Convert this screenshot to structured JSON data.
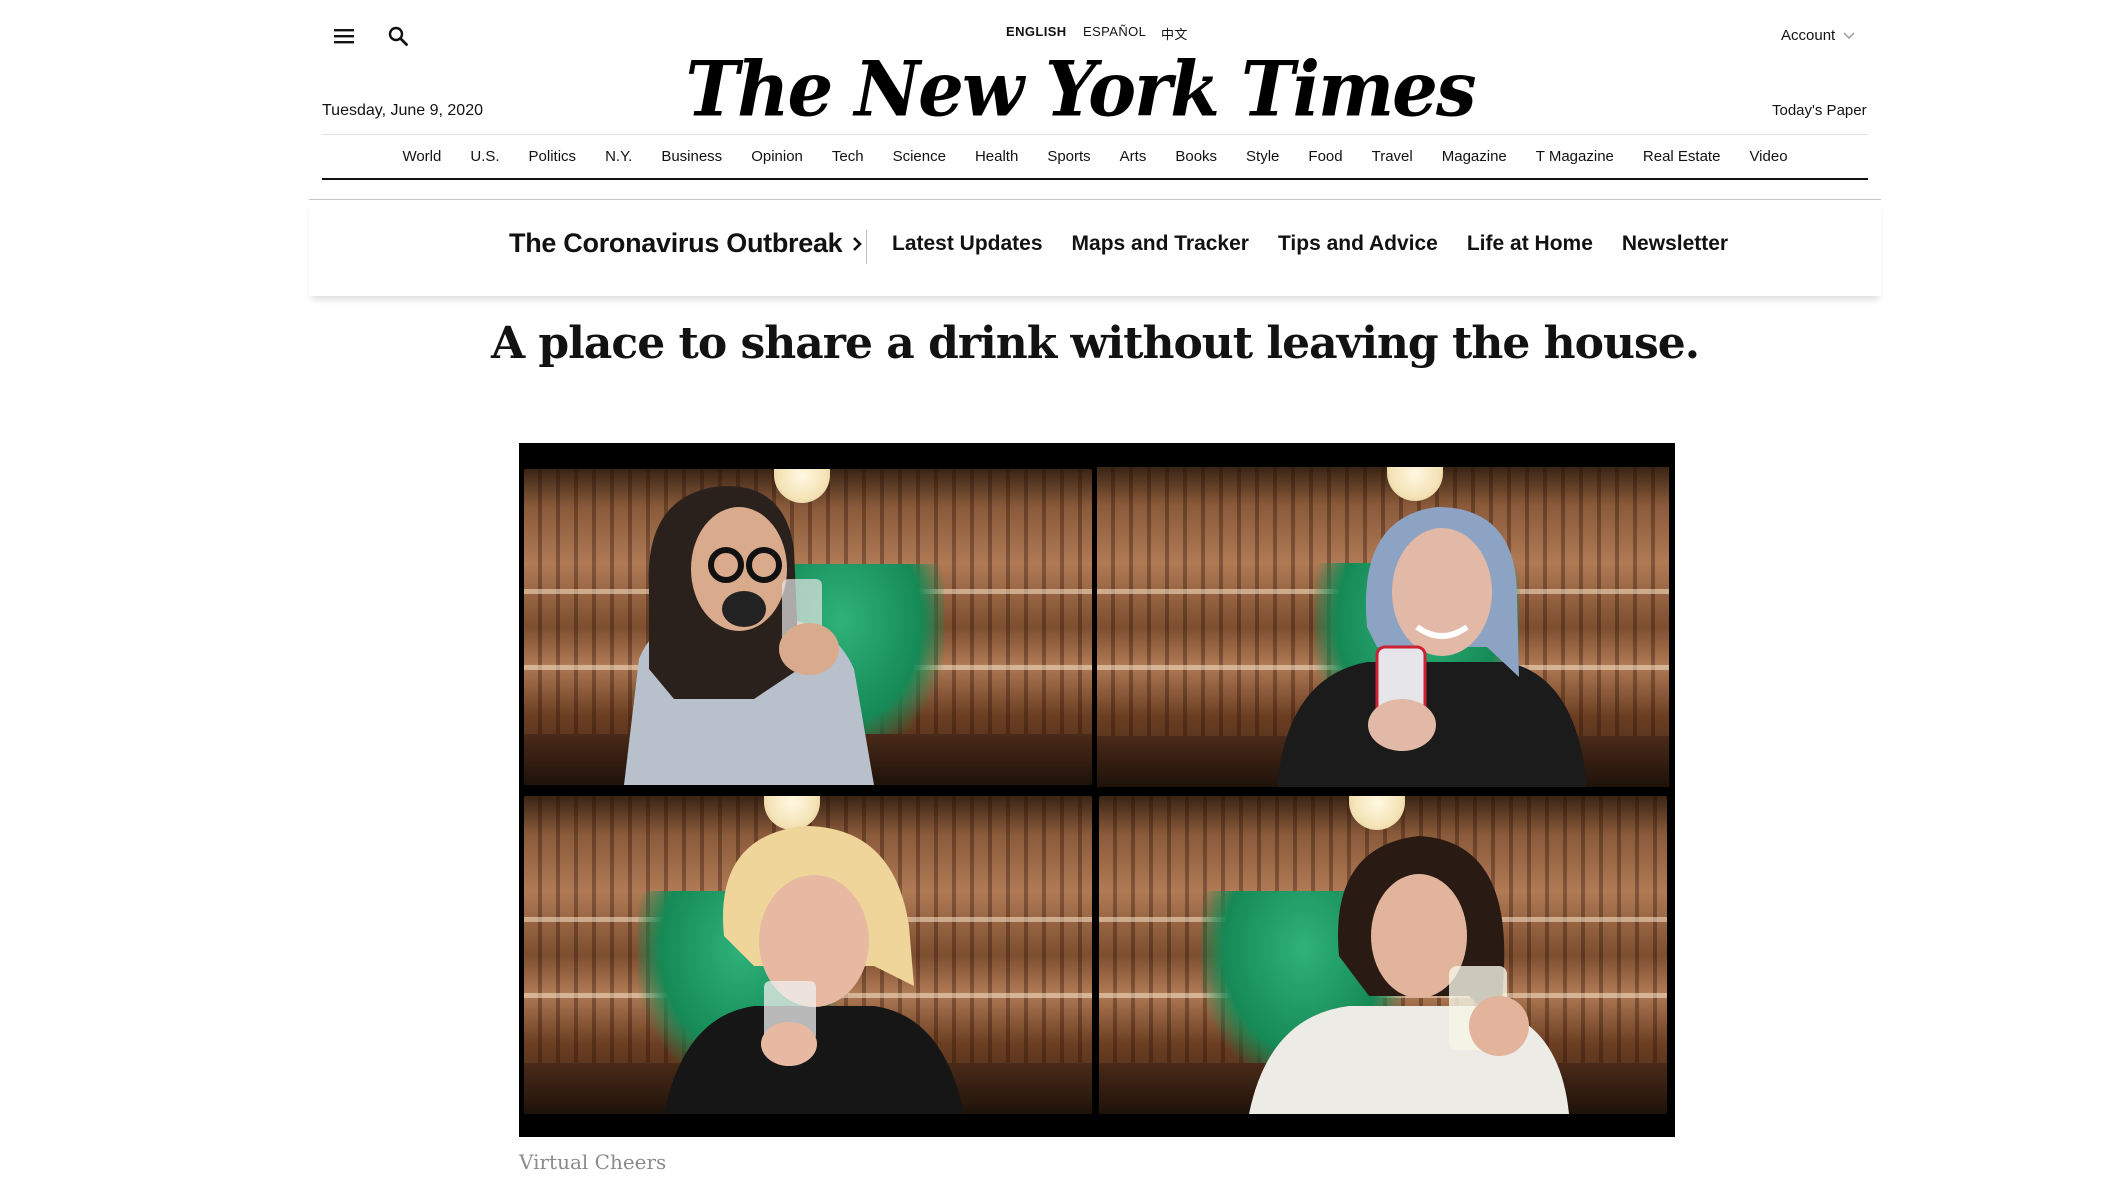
{
  "masthead": {
    "languages": [
      {
        "label": "ENGLISH",
        "active": true
      },
      {
        "label": "ESPAÑOL",
        "active": false
      },
      {
        "label": "中文",
        "active": false
      }
    ],
    "logo": "The New York Times",
    "date": "Tuesday, June 9, 2020",
    "account_label": "Account",
    "todays_paper": "Today's Paper",
    "icons": {
      "menu": "menu-icon",
      "search": "search-icon",
      "account_caret": "chevron-down-icon"
    }
  },
  "sections": [
    "World",
    "U.S.",
    "Politics",
    "N.Y.",
    "Business",
    "Opinion",
    "Tech",
    "Science",
    "Health",
    "Sports",
    "Arts",
    "Books",
    "Style",
    "Food",
    "Travel",
    "Magazine",
    "T Magazine",
    "Real Estate",
    "Video"
  ],
  "story_bar": {
    "title": "The Coronavirus Outbreak",
    "links": [
      "Latest Updates",
      "Maps and Tracker",
      "Tips and Advice",
      "Life at Home",
      "Newsletter"
    ]
  },
  "article": {
    "headline": "A place to share a drink without leaving the house.",
    "caption": "Virtual Cheers"
  },
  "colors": {
    "active_tile_border": "#d6e26d",
    "caption": "#8b8b8b",
    "text": "#121212"
  }
}
